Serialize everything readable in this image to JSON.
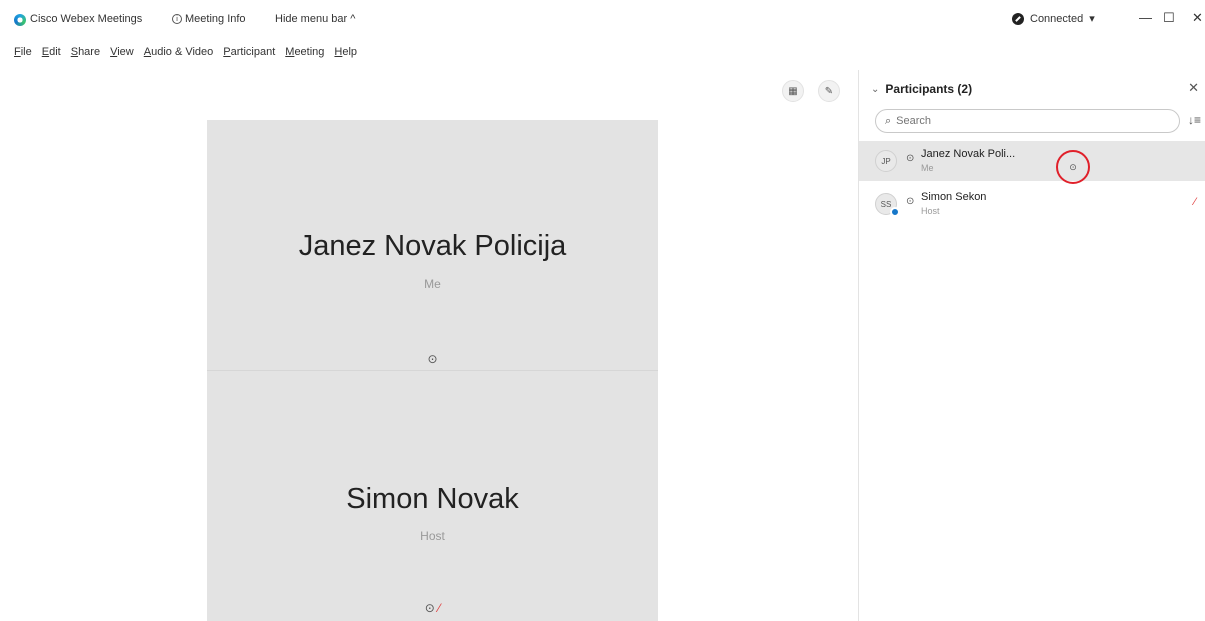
{
  "titlebar": {
    "app_title": "Cisco Webex Meetings",
    "meeting_info": "Meeting Info",
    "hide_menu": "Hide menu bar ^",
    "connected": "Connected",
    "conn_chevron": "▾",
    "minimize": "—",
    "maximize": "☐",
    "close": "✕"
  },
  "menubar": {
    "items": [
      "File",
      "Edit",
      "Share",
      "View",
      "Audio & Video",
      "Participant",
      "Meeting",
      "Help"
    ]
  },
  "stage": {
    "layout_icon": "▦",
    "pen_icon": "✎",
    "tiles": [
      {
        "name": "Janez Novak Policija",
        "role": "Me",
        "mic": "⊙",
        "muted": ""
      },
      {
        "name": "Simon Novak",
        "role": "Host",
        "mic": "⊙",
        "muted": "⁄"
      }
    ]
  },
  "panel": {
    "title": "Participants (2)",
    "chevron": "⌄",
    "close": "✕",
    "search_placeholder": "Search",
    "search_icon": "⌕",
    "sort_icon": "↓≡",
    "participants": [
      {
        "initials": "JP",
        "mic": "⊙",
        "name": "Janez Novak Poli...",
        "role": "Me",
        "action": "⊙"
      },
      {
        "initials": "SS",
        "mic": "⊙",
        "name": "Simon Sekon",
        "role": "Host",
        "mute": "⁄"
      }
    ]
  },
  "colors": {
    "highlight_ring": "#e0202a",
    "tile_bg": "#e3e3e3",
    "host_badge": "#1677c9",
    "muted": "#e03b3b"
  }
}
